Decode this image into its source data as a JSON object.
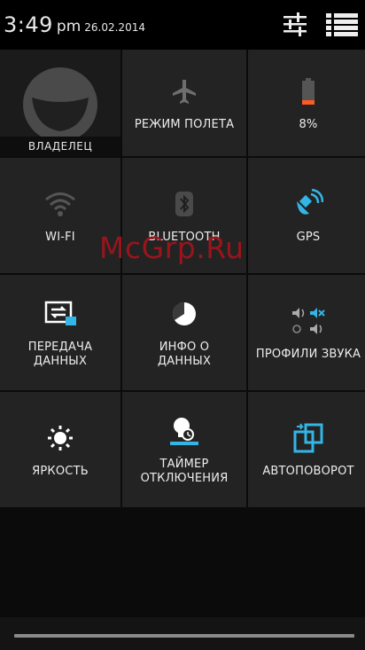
{
  "status": {
    "time": "3:49",
    "ampm": "pm",
    "date": "26.02.2014"
  },
  "tiles": {
    "owner": "ВЛАДЕЛЕЦ",
    "airplane": "РЕЖИМ ПОЛЕТА",
    "battery": "8%",
    "wifi": "WI-FI",
    "bluetooth": "BLUETOOTH",
    "gps": "GPS",
    "data_line1": "ПЕРЕДАЧА",
    "data_line2": "ДАННЫХ",
    "datainfo_line1": "ИНФО О",
    "datainfo_line2": "ДАННЫХ",
    "sound": "ПРОФИЛИ ЗВУКА",
    "brightness": "ЯРКОСТЬ",
    "timer_line1": "ТАЙМЕР",
    "timer_line2": "ОТКЛЮЧЕНИЯ",
    "rotate": "АВТОПОВОРОТ"
  },
  "watermark": "McGrp.Ru",
  "colors": {
    "accent": "#33b5e5",
    "battery_low": "#ff5a1f",
    "watermark": "#9a141c"
  }
}
